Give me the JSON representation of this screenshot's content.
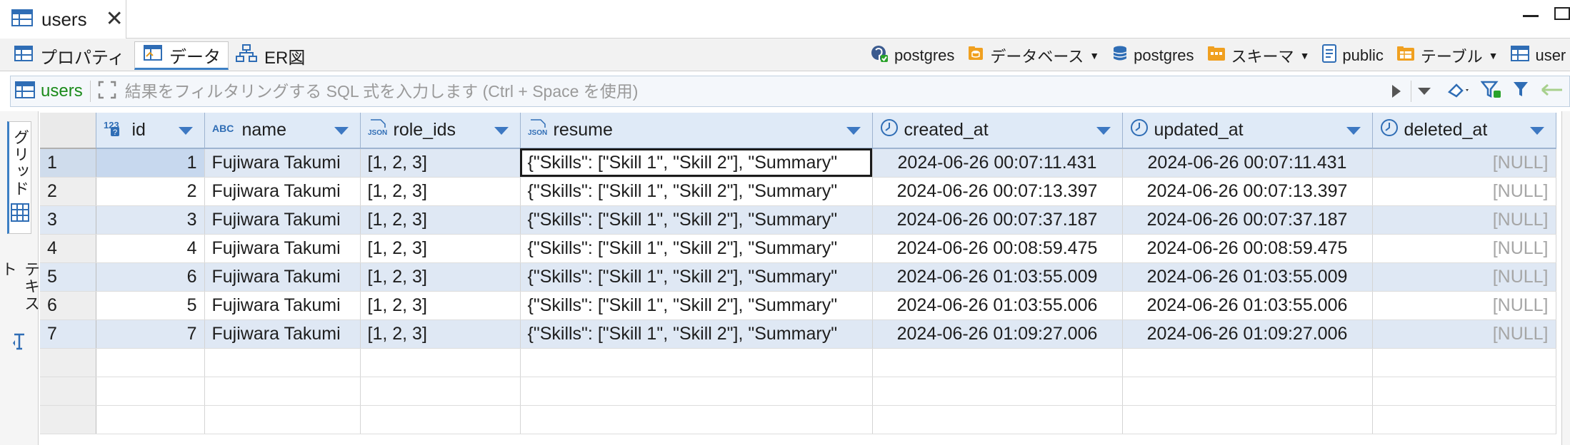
{
  "editor_tab": {
    "title": "users"
  },
  "subtabs": [
    {
      "label": "プロパティ",
      "icon": "properties-icon"
    },
    {
      "label": "データ",
      "icon": "data-grid-icon",
      "active": true
    },
    {
      "label": "ER図",
      "icon": "er-diagram-icon"
    }
  ],
  "breadcrumbs": [
    {
      "label": "postgres",
      "icon": "postgres-connection-icon",
      "caret": false
    },
    {
      "label": "データベース",
      "icon": "database-folder-icon",
      "caret": true
    },
    {
      "label": "postgres",
      "icon": "database-icon",
      "caret": false
    },
    {
      "label": "スキーマ",
      "icon": "schema-folder-icon",
      "caret": true
    },
    {
      "label": "public",
      "icon": "schema-icon",
      "caret": false
    },
    {
      "label": "テーブル",
      "icon": "tables-folder-icon",
      "caret": true
    },
    {
      "label": "user",
      "icon": "table-icon",
      "caret": false
    }
  ],
  "filter": {
    "entity": "users",
    "placeholder": "結果をフィルタリングする SQL 式を入力します (Ctrl + Space を使用)"
  },
  "side_tabs": {
    "grid": "グリッド",
    "text": "テキスト"
  },
  "columns": [
    {
      "name": "id",
      "type": "123"
    },
    {
      "name": "name",
      "type": "ABC"
    },
    {
      "name": "role_ids",
      "type": "JSON"
    },
    {
      "name": "resume",
      "type": "JSON"
    },
    {
      "name": "created_at",
      "type": "clock"
    },
    {
      "name": "updated_at",
      "type": "clock"
    },
    {
      "name": "deleted_at",
      "type": "clock"
    }
  ],
  "rows": [
    {
      "n": "1",
      "id": "1",
      "name": "Fujiwara Takumi",
      "role_ids": "[1, 2, 3]",
      "resume": "{\"Skills\": [\"Skill 1\", \"Skill 2\"], \"Summary\"",
      "created_at": "2024-06-26 00:07:11.431",
      "updated_at": "2024-06-26 00:07:11.431",
      "deleted_at": "[NULL]"
    },
    {
      "n": "2",
      "id": "2",
      "name": "Fujiwara Takumi",
      "role_ids": "[1, 2, 3]",
      "resume": "{\"Skills\": [\"Skill 1\", \"Skill 2\"], \"Summary\"",
      "created_at": "2024-06-26 00:07:13.397",
      "updated_at": "2024-06-26 00:07:13.397",
      "deleted_at": "[NULL]"
    },
    {
      "n": "3",
      "id": "3",
      "name": "Fujiwara Takumi",
      "role_ids": "[1, 2, 3]",
      "resume": "{\"Skills\": [\"Skill 1\", \"Skill 2\"], \"Summary\"",
      "created_at": "2024-06-26 00:07:37.187",
      "updated_at": "2024-06-26 00:07:37.187",
      "deleted_at": "[NULL]"
    },
    {
      "n": "4",
      "id": "4",
      "name": "Fujiwara Takumi",
      "role_ids": "[1, 2, 3]",
      "resume": "{\"Skills\": [\"Skill 1\", \"Skill 2\"], \"Summary\"",
      "created_at": "2024-06-26 00:08:59.475",
      "updated_at": "2024-06-26 00:08:59.475",
      "deleted_at": "[NULL]"
    },
    {
      "n": "5",
      "id": "6",
      "name": "Fujiwara Takumi",
      "role_ids": "[1, 2, 3]",
      "resume": "{\"Skills\": [\"Skill 1\", \"Skill 2\"], \"Summary\"",
      "created_at": "2024-06-26 01:03:55.009",
      "updated_at": "2024-06-26 01:03:55.009",
      "deleted_at": "[NULL]"
    },
    {
      "n": "6",
      "id": "5",
      "name": "Fujiwara Takumi",
      "role_ids": "[1, 2, 3]",
      "resume": "{\"Skills\": [\"Skill 1\", \"Skill 2\"], \"Summary\"",
      "created_at": "2024-06-26 01:03:55.006",
      "updated_at": "2024-06-26 01:03:55.006",
      "deleted_at": "[NULL]"
    },
    {
      "n": "7",
      "id": "7",
      "name": "Fujiwara Takumi",
      "role_ids": "[1, 2, 3]",
      "resume": "{\"Skills\": [\"Skill 1\", \"Skill 2\"], \"Summary\"",
      "created_at": "2024-06-26 01:09:27.006",
      "updated_at": "2024-06-26 01:09:27.006",
      "deleted_at": "[NULL]"
    }
  ],
  "colors": {
    "accent": "#3c7fc4",
    "header_bg": "#dfeaf7",
    "alt_row": "#dfe8f4",
    "null_text": "#a6a6a6",
    "entity_green": "#1a8a1a"
  }
}
